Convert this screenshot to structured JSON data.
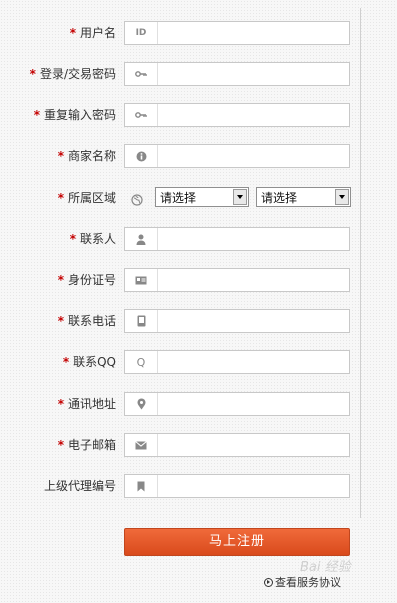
{
  "form": {
    "fields": [
      {
        "label": "用户名",
        "required": true,
        "icon": "id-icon",
        "icon_glyph": "ID",
        "value": ""
      },
      {
        "label": "登录/交易密码",
        "required": true,
        "icon": "key-icon",
        "icon_glyph": "⊶",
        "value": ""
      },
      {
        "label": "重复输入密码",
        "required": true,
        "icon": "key-icon",
        "icon_glyph": "⊶",
        "value": ""
      },
      {
        "label": "商家名称",
        "required": true,
        "icon": "info-icon",
        "icon_glyph": "❶",
        "value": ""
      },
      {
        "label": "所属区域",
        "required": true,
        "icon": "globe-icon",
        "icon_glyph": "◎",
        "select1": "请选择",
        "select2": "请选择"
      },
      {
        "label": "联系人",
        "required": true,
        "icon": "person-icon",
        "icon_glyph": "👤",
        "value": ""
      },
      {
        "label": "身份证号",
        "required": true,
        "icon": "id-card-icon",
        "icon_glyph": "▭",
        "value": ""
      },
      {
        "label": "联系电话",
        "required": true,
        "icon": "phone-icon",
        "icon_glyph": "▯",
        "value": ""
      },
      {
        "label": "联系QQ",
        "required": true,
        "icon": "qq-icon",
        "icon_glyph": "Q",
        "value": ""
      },
      {
        "label": "通讯地址",
        "required": true,
        "icon": "location-pin-icon",
        "icon_glyph": "⚲",
        "value": ""
      },
      {
        "label": "电子邮箱",
        "required": true,
        "icon": "mail-icon",
        "icon_glyph": "✉",
        "value": ""
      },
      {
        "label": "上级代理编号",
        "required": false,
        "icon": "bookmark-icon",
        "icon_glyph": "▮",
        "value": ""
      }
    ],
    "submit_label": "马上注册",
    "terms_link": "查看服务协议"
  },
  "watermark": "Bai 经验",
  "colors": {
    "required": "#c40000",
    "button": "#e2562a"
  }
}
